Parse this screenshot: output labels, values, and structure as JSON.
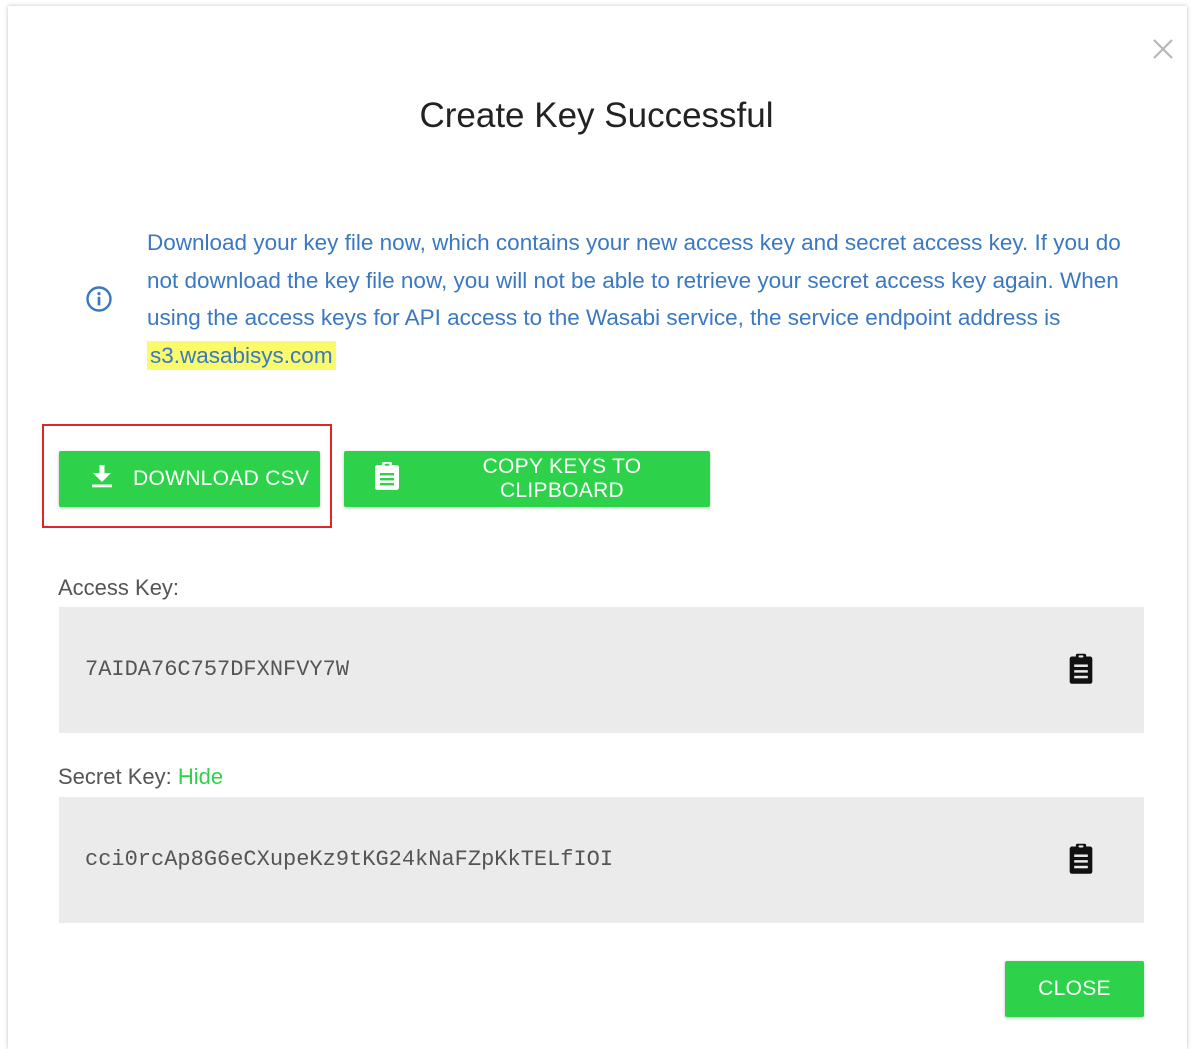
{
  "dialog": {
    "title": "Create Key Successful",
    "close_icon": "close-x-icon",
    "info": {
      "icon": "info-icon",
      "text_before": "Download your key file now, which contains your new access key and secret access key. If you do not download the key file now, you will not be able to retrieve your secret access key again. When using the access keys for API access to the Wasabi service, the service endpoint address is ",
      "endpoint": "s3.wasabisys.com"
    },
    "buttons": {
      "download_label": "DOWNLOAD CSV",
      "copy_label": "COPY KEYS TO CLIPBOARD",
      "close_label": "CLOSE"
    },
    "access_key": {
      "label": "Access Key:",
      "value": "7AIDA76C757DFXNFVY7W"
    },
    "secret_key": {
      "label": "Secret Key:",
      "hide_label": "Hide",
      "value": "cci0rcAp8G6eCXupeKz9tKG24kNaFZpKkTELfIOI"
    }
  },
  "colors": {
    "accent_green": "#2ed24a",
    "info_blue": "#3a78c2",
    "highlight_yellow": "#fafa6b",
    "annotation_red": "#e0242a",
    "key_box_bg": "#ebebeb"
  }
}
